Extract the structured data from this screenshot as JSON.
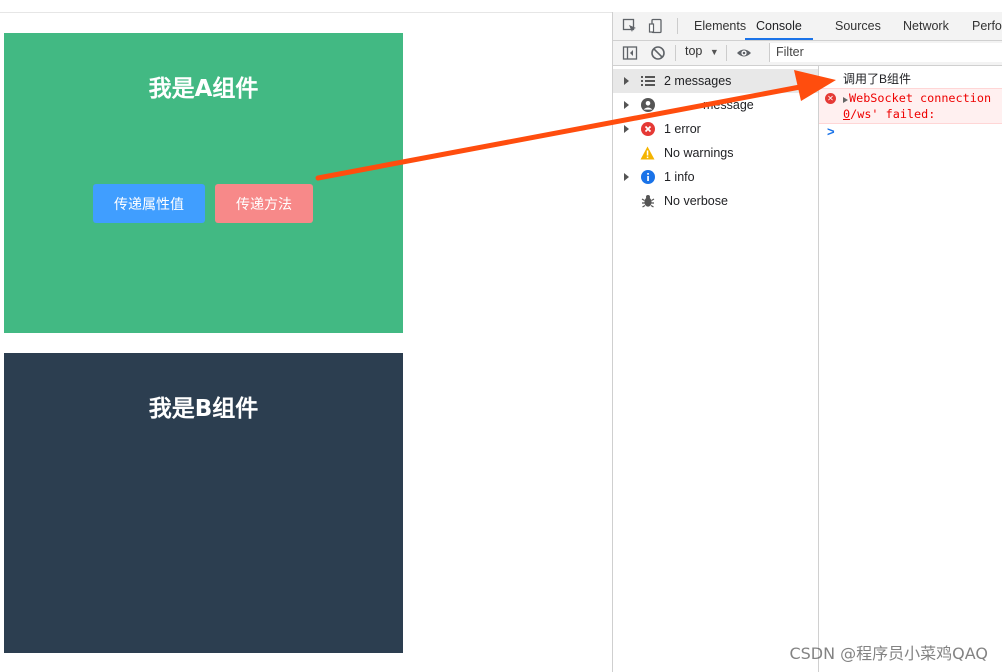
{
  "app": {
    "component_a": {
      "title": "我是A组件",
      "btn_prop": "传递属性值",
      "btn_method": "传递方法"
    },
    "component_b": {
      "title": "我是B组件"
    }
  },
  "devtools": {
    "tabs": [
      {
        "label": "Elements"
      },
      {
        "label": "Console",
        "active": true
      },
      {
        "label": "Sources"
      },
      {
        "label": "Network"
      },
      {
        "label": "Perfor"
      }
    ],
    "toolbar": {
      "context": "top",
      "filter_placeholder": "Filter"
    },
    "sidebar": [
      {
        "label": "2 messages",
        "icon": "list-icon"
      },
      {
        "label": "1 user message",
        "visible_label": "message",
        "icon": "user-icon"
      },
      {
        "label": "1 error",
        "icon": "error-icon"
      },
      {
        "label": "No warnings",
        "icon": "warning-icon"
      },
      {
        "label": "1 info",
        "icon": "info-icon"
      },
      {
        "label": "No verbose",
        "icon": "bug-icon"
      }
    ],
    "console": {
      "log": "调用了B组件",
      "error_line1": "WebSocket connection",
      "error_line2": "0/ws' failed:",
      "prompt": ">"
    }
  },
  "watermark": "CSDN @程序员小菜鸡QAQ",
  "colors": {
    "comp_a": "#42b983",
    "comp_b": "#2c3e50",
    "btn_prop": "#409eff",
    "btn_method": "#f78989",
    "arrow": "#ff4d0e"
  }
}
